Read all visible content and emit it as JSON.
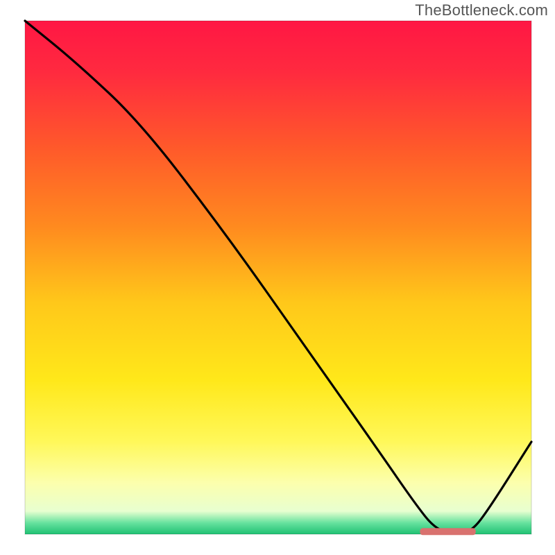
{
  "watermark": "TheBottleneck.com",
  "chart_data": {
    "type": "line",
    "title": "",
    "xlabel": "",
    "ylabel": "",
    "xlim": [
      0,
      100
    ],
    "ylim": [
      0,
      100
    ],
    "background_gradient": {
      "stops": [
        {
          "offset": 0.0,
          "color": "#ff1744"
        },
        {
          "offset": 0.1,
          "color": "#ff2a3f"
        },
        {
          "offset": 0.25,
          "color": "#ff5a2a"
        },
        {
          "offset": 0.4,
          "color": "#ff8a1f"
        },
        {
          "offset": 0.55,
          "color": "#ffc81a"
        },
        {
          "offset": 0.7,
          "color": "#ffe81a"
        },
        {
          "offset": 0.82,
          "color": "#fff85a"
        },
        {
          "offset": 0.9,
          "color": "#fcffad"
        },
        {
          "offset": 0.955,
          "color": "#e8ffd0"
        },
        {
          "offset": 0.978,
          "color": "#66e29e"
        },
        {
          "offset": 1.0,
          "color": "#1fc173"
        }
      ]
    },
    "series": [
      {
        "name": "curve",
        "color": "#000000",
        "x": [
          0,
          10,
          23,
          40,
          55,
          70,
          77,
          81,
          85,
          88,
          91,
          100
        ],
        "y": [
          100,
          92,
          80,
          58,
          37,
          16,
          6,
          1,
          0,
          0.5,
          4,
          18
        ]
      }
    ],
    "optimal_marker": {
      "x_range": [
        78,
        89
      ],
      "y": 0.5,
      "color": "#d9726f"
    }
  }
}
